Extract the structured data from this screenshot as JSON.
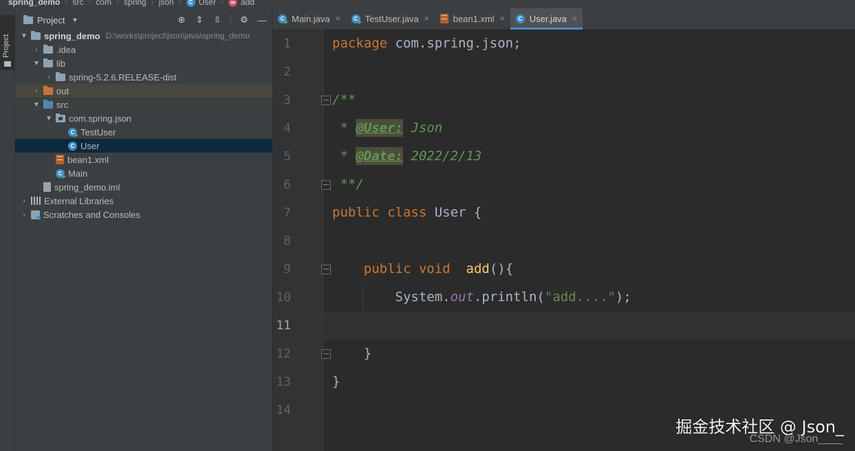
{
  "breadcrumb": {
    "items": [
      "spring_demo",
      "src",
      "com",
      "spring",
      "json",
      "User",
      "add"
    ]
  },
  "tool_window": {
    "stripe_label": "Project",
    "title": "Project"
  },
  "tree": {
    "root": {
      "label": "spring_demo",
      "path": "D:\\works\\project\\json\\java\\spring_demo"
    },
    "idea": "idea",
    "lib": "lib",
    "spring_dist": "spring-5.2.6.RELEASE-dist",
    "out": "out",
    "src": "src",
    "package": "com.spring.json",
    "test_user": "TestUser",
    "user": "User",
    "bean1": "bean1.xml",
    "main": "Main",
    "iml": "spring_demo.iml",
    "external_libraries": "External Libraries",
    "scratches": "Scratches and Consoles"
  },
  "tabs": [
    {
      "label": "Main.java",
      "icon": "java-class-icon",
      "active": false
    },
    {
      "label": "TestUser.java",
      "icon": "java-class-icon",
      "active": false
    },
    {
      "label": "bean1.xml",
      "icon": "xml-file-icon",
      "active": false
    },
    {
      "label": "User.java",
      "icon": "java-class-icon",
      "active": true
    }
  ],
  "editor": {
    "line_numbers": [
      "1",
      "2",
      "3",
      "4",
      "5",
      "6",
      "7",
      "8",
      "9",
      "10",
      "11",
      "12",
      "13",
      "14"
    ],
    "current_line": "11",
    "code": {
      "l1_kw": "package",
      "l1_rest": " com.spring.json;",
      "l3": "/**",
      "l4_prefix": " * ",
      "l4_tag": "@User:",
      "l4_text": " Json",
      "l5_prefix": " * ",
      "l5_tag": "@Date:",
      "l5_text": " 2022/2/13",
      "l6": " **/",
      "l7_kw1": "public",
      "l7_kw2": "class",
      "l7_rest": " User {",
      "l9_kw1": "public",
      "l9_kw2": "void",
      "l9_fn": "add",
      "l9_rest": "(){",
      "l10_obj": "System.",
      "l10_field": "out",
      "l10_call": ".println(",
      "l10_str": "\"add....\"",
      "l10_end": ");",
      "l12": "}",
      "l13": "}"
    }
  },
  "watermark": {
    "main": "掘金技术社区 @ Json_",
    "sub": "CSDN @Json____"
  },
  "colors": {
    "keyword": "#cc7832",
    "doc_comment": "#629755",
    "string": "#6a8759",
    "function": "#ffc66d",
    "static_field": "#9876aa",
    "default_text": "#a9b7c6",
    "selection": "#0d293e",
    "active_tab_underline": "#4a88c7"
  }
}
